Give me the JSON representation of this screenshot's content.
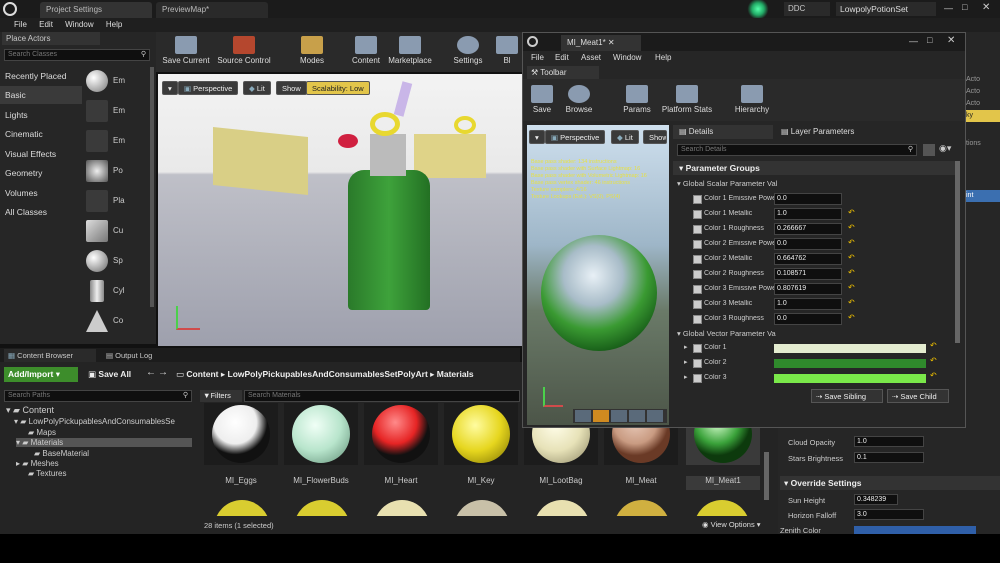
{
  "tabs": {
    "project": "Project Settings",
    "preview": "PreviewMap*",
    "ddc": "DDC",
    "project_name": "LowpolyPotionSet"
  },
  "menu": [
    "File",
    "Edit",
    "Window",
    "Help"
  ],
  "place_actors": {
    "title": "Place Actors",
    "search_placeholder": "Search Classes",
    "categories": [
      "Recently Placed",
      "Basic",
      "Lights",
      "Cinematic",
      "Visual Effects",
      "Geometry",
      "Volumes",
      "All Classes"
    ],
    "actors": [
      "Em",
      "Em",
      "Em",
      "Po",
      "Pla",
      "Cu",
      "Sp",
      "Cyl",
      "Co"
    ]
  },
  "toolbar": [
    "Save Current",
    "Source Control",
    "Modes",
    "Content",
    "Marketplace",
    "Settings",
    "Bl"
  ],
  "viewport": {
    "perspective": "Perspective",
    "lit": "Lit",
    "show": "Show",
    "scalability": "Scalability: Low"
  },
  "content_browser": {
    "tab": "Content Browser",
    "output": "Output Log",
    "add_import": "Add/Import",
    "save_all": "Save All",
    "path": [
      "Content",
      "LowPolyPickupablesAndConsumablesSetPolyArt",
      "Materials"
    ],
    "search_paths": "Search Paths",
    "filters": "Filters",
    "search_materials": "Search Materials",
    "tree": [
      "Content",
      "LowPolyPickupablesAndConsumablesSe",
      "Maps",
      "Materials",
      "BaseMaterial",
      "Meshes",
      "Textures"
    ],
    "assets": [
      "MI_Eggs",
      "MI_FlowerBuds",
      "MI_Heart",
      "MI_Key",
      "MI_LootBag",
      "MI_Meat",
      "MI_Meat1"
    ],
    "count": "28 items (1 selected)",
    "view_options": "View Options"
  },
  "material_editor": {
    "title": "MI_Meat1*",
    "menu": [
      "File",
      "Edit",
      "Asset",
      "Window",
      "Help"
    ],
    "toolbar_tab": "Toolbar",
    "buttons": [
      "Save",
      "Browse",
      "Params",
      "Platform Stats",
      "Hierarchy"
    ],
    "vp": {
      "perspective": "Perspective",
      "lit": "Lit",
      "show": "Show"
    },
    "stats": [
      "Base pass shader: 134 instructions",
      "Base pass shader with Surface Lightmap: 16",
      "Base pass shader with Volumetric Lightmap: 16",
      "Base pass vertex shader: 46 instructions",
      "Texture samplers: 4/16",
      "Texture Lookups (Est.): VS(0), PS(4)"
    ],
    "details_tab": "Details",
    "layer_tab": "Layer Parameters",
    "search_details": "Search Details",
    "groups": "Parameter Groups",
    "scalar_group": "Global Scalar Parameter Val",
    "scalars": [
      {
        "name": "Color 1 Emissive Powe",
        "value": "0.0",
        "reset": false
      },
      {
        "name": "Color 1 Metallic",
        "value": "1.0",
        "reset": true
      },
      {
        "name": "Color 1 Roughness",
        "value": "0.266667",
        "reset": true
      },
      {
        "name": "Color 2 Emissive Powe",
        "value": "0.0",
        "reset": true
      },
      {
        "name": "Color 2 Metallic",
        "value": "0.664762",
        "reset": true
      },
      {
        "name": "Color 2 Roughness",
        "value": "0.108571",
        "reset": true
      },
      {
        "name": "Color 3 Emissive Powe",
        "value": "0.807619",
        "reset": true
      },
      {
        "name": "Color 3 Metallic",
        "value": "1.0",
        "reset": true
      },
      {
        "name": "Color 3 Roughness",
        "value": "0.0",
        "reset": true
      }
    ],
    "vector_group": "Global Vector Parameter Va",
    "vectors": [
      {
        "name": "Color 1",
        "color": "#e4ecd0"
      },
      {
        "name": "Color 2",
        "color": "#2f8a2c"
      },
      {
        "name": "Color 3",
        "color": "#7ae84a"
      }
    ],
    "save_sibling": "Save Sibling",
    "save_child": "Save Child"
  },
  "right_panel": {
    "cloud_opacity_label": "Cloud Opacity",
    "cloud_opacity": "1.0",
    "stars_label": "Stars Brightness",
    "stars": "0.1",
    "override": "Override Settings",
    "sun_height_label": "Sun Height",
    "sun_height": "0.348239",
    "horizon_label": "Horizon Falloff",
    "horizon": "3.0",
    "zenith_label": "Zenith Color",
    "frag": [
      "Acto",
      "Acto",
      "Acto",
      "ky",
      "tions",
      "int"
    ]
  }
}
